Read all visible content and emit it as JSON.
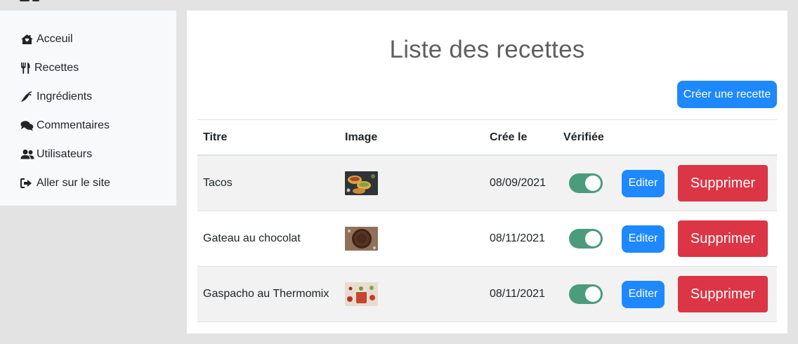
{
  "sidebar": {
    "items": [
      {
        "label": "Acceuil",
        "icon": "home-icon"
      },
      {
        "label": "Recettes",
        "icon": "utensils-icon"
      },
      {
        "label": "Ingrédients",
        "icon": "pepper-icon"
      },
      {
        "label": "Commentaires",
        "icon": "comments-icon"
      },
      {
        "label": "Utilisateurs",
        "icon": "users-icon"
      },
      {
        "label": "Aller sur le site",
        "icon": "sign-out-icon"
      }
    ]
  },
  "main": {
    "title": "Liste des recettes",
    "create_label": "Créer une recette",
    "columns": [
      "Titre",
      "Image",
      "Crée le",
      "Vérifiée"
    ],
    "rows": [
      {
        "title": "Tacos",
        "date": "08/09/2021",
        "verified": true,
        "edit": "Editer",
        "delete": "Supprimer",
        "image": "tacos-thumbnail"
      },
      {
        "title": "Gateau au chocolat",
        "date": "08/11/2021",
        "verified": true,
        "edit": "Editer",
        "delete": "Supprimer",
        "image": "chocolate-cake-thumbnail"
      },
      {
        "title": "Gaspacho au Thermomix",
        "date": "08/11/2021",
        "verified": true,
        "edit": "Editer",
        "delete": "Supprimer",
        "image": "gazpacho-thumbnail"
      }
    ]
  },
  "colors": {
    "primary": "#1e88ff",
    "danger": "#dc3545",
    "toggle_on": "#4a9c7d"
  }
}
